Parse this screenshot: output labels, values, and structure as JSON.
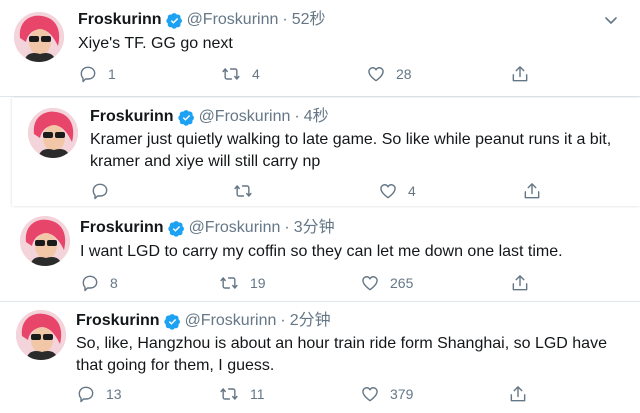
{
  "colors": {
    "text": "#14171a",
    "secondary": "#657786",
    "verified": "#1da1f2",
    "divider": "#e1e8ed",
    "avatar_hair": "#e8456b"
  },
  "icons": {
    "verified": "verified-badge-icon",
    "menu": "chevron-down-icon",
    "reply": "reply-icon",
    "retweet": "retweet-icon",
    "like": "heart-icon",
    "share": "share-icon"
  },
  "tweets": [
    {
      "name": "Froskurinn",
      "handle": "@Froskurinn",
      "time": "52秒",
      "lines": [
        "Xiye's TF. GG go next"
      ],
      "replies": "1",
      "retweets": "4",
      "likes": "28"
    },
    {
      "name": "Froskurinn",
      "handle": "@Froskurinn",
      "time": "4秒",
      "lines": [
        "Kramer just quietly walking to late game. So like while peanut runs it a bit,",
        "kramer and xiye will still carry np"
      ],
      "replies": "",
      "retweets": "",
      "likes": "4"
    },
    {
      "name": "Froskurinn",
      "handle": "@Froskurinn",
      "time": "3分钟",
      "lines": [
        "I want LGD to carry my coffin so they can let me down one last time."
      ],
      "replies": "8",
      "retweets": "19",
      "likes": "265"
    },
    {
      "name": "Froskurinn",
      "handle": "@Froskurinn",
      "time": "2分钟",
      "lines": [
        "So, like, Hangzhou is about an hour train ride form Shanghai, so LGD have",
        "that going for them, I guess."
      ],
      "replies": "13",
      "retweets": "11",
      "likes": "379"
    }
  ]
}
